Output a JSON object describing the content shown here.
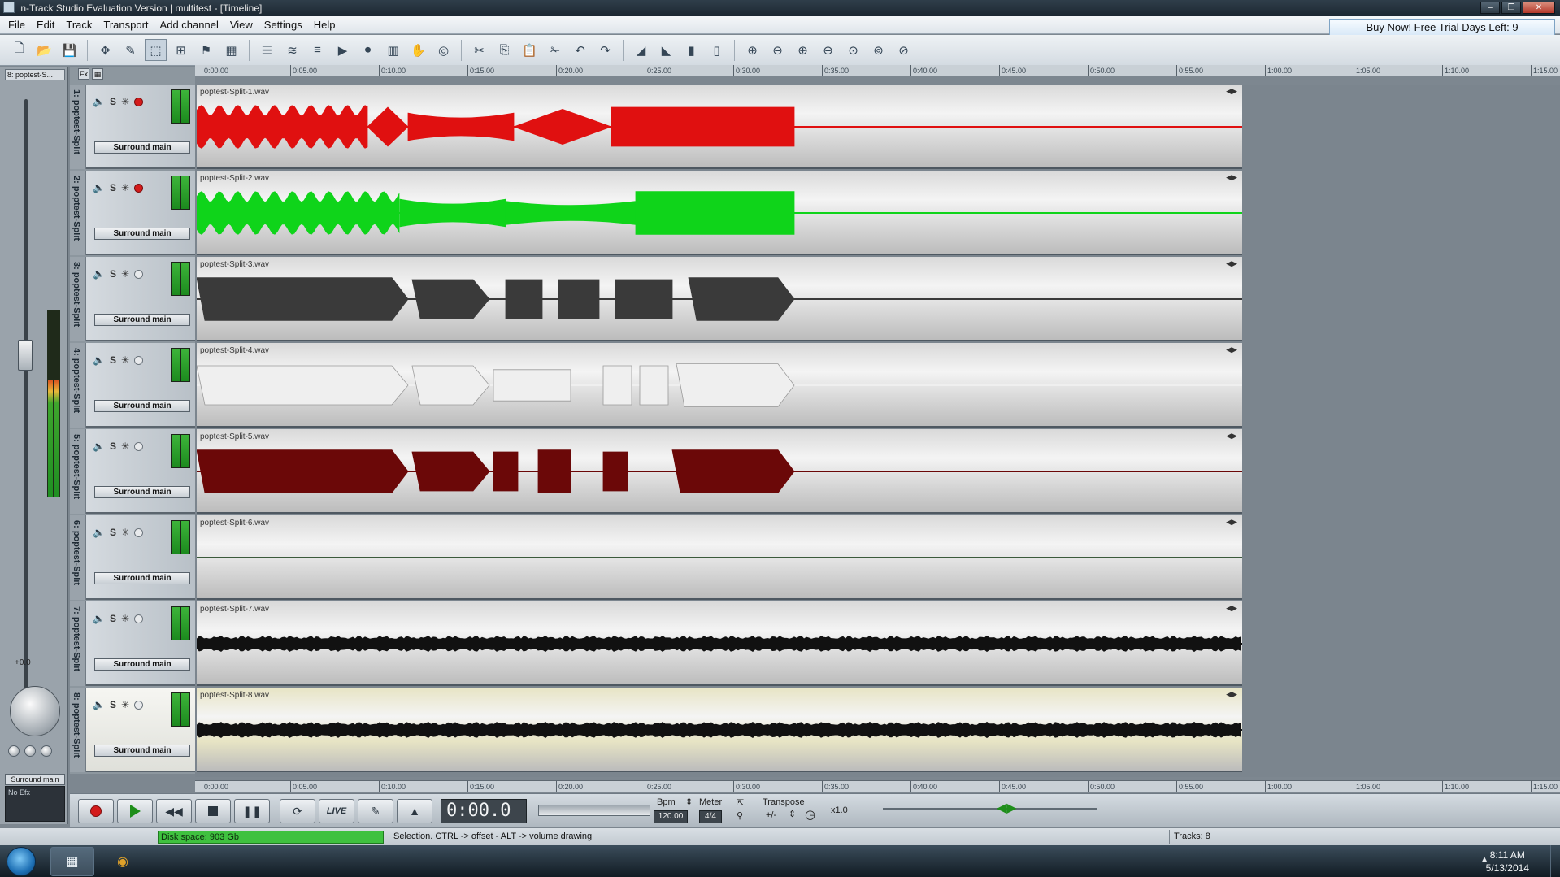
{
  "window": {
    "title": "n-Track Studio Evaluation Version | multitest - [Timeline]",
    "controls": {
      "minimize": "–",
      "maximize": "❐",
      "close": "✕"
    }
  },
  "menu": [
    "File",
    "Edit",
    "Track",
    "Transport",
    "Add channel",
    "View",
    "Settings",
    "Help"
  ],
  "buy_now": "Buy Now! Free Trial Days Left: 9",
  "toolbar_icons": [
    "new-file-icon",
    "open-file-icon",
    "save-icon",
    "move-icon",
    "edit-tool-icon",
    "select-tool-icon",
    "snap-icon",
    "marker-icon",
    "grid-icon",
    "mixer-icon",
    "eq-icon",
    "list-icon",
    "loop-play-icon",
    "record-mode-icon",
    "piano-icon",
    "hand-icon",
    "cd-icon",
    "cut-icon",
    "copy-icon",
    "paste-icon",
    "trim-icon",
    "undo-icon",
    "redo-icon",
    "fade-in-icon",
    "fade-out-icon",
    "normalize-icon",
    "meter-icon",
    "zoom-in-h-icon",
    "zoom-out-h-icon",
    "zoom-in-v-icon",
    "zoom-out-v-icon",
    "zoom-fit-icon",
    "zoom-all-icon",
    "zoom-reset-icon"
  ],
  "left_strip": {
    "tab": "8: poptest-S...",
    "gain": "+0.0",
    "output": "Surround main",
    "efx": "No Efx"
  },
  "header_top": [
    "Fx",
    "▦"
  ],
  "tracks": [
    {
      "name": "1: poptest-Split",
      "clip": "poptest-Split-1.wav",
      "output": "Surround main",
      "color": "#e01010",
      "fill": "#d9d9d9",
      "armed": true
    },
    {
      "name": "2: poptest-Split",
      "clip": "poptest-Split-2.wav",
      "output": "Surround main",
      "color": "#0fd41a",
      "fill": "#d9d9d9",
      "armed": true
    },
    {
      "name": "3: poptest-Split",
      "clip": "poptest-Split-3.wav",
      "output": "Surround main",
      "color": "#3a3a3a",
      "fill": "#d9d9d9",
      "armed": false
    },
    {
      "name": "4: poptest-Split",
      "clip": "poptest-Split-4.wav",
      "output": "Surround main",
      "color": "#efefef",
      "fill": "#d9d9d9",
      "armed": false
    },
    {
      "name": "5: poptest-Split",
      "clip": "poptest-Split-5.wav",
      "output": "Surround main",
      "color": "#6b0808",
      "fill": "#d9d9d9",
      "armed": false
    },
    {
      "name": "6: poptest-Split",
      "clip": "poptest-Split-6.wav",
      "output": "Surround main",
      "color": "#3a5a3a",
      "fill": "#d9d9d9",
      "armed": false
    },
    {
      "name": "7: poptest-Split",
      "clip": "poptest-Split-7.wav",
      "output": "Surround main",
      "color": "#111111",
      "fill": "#d9d9d9",
      "armed": false
    },
    {
      "name": "8: poptest-Split",
      "clip": "poptest-Split-8.wav",
      "output": "Surround main",
      "color": "#111111",
      "fill": "#e7e4c4",
      "armed": false
    }
  ],
  "ruler": [
    "0:00.00",
    "0:05.00",
    "0:10.00",
    "0:15.00",
    "0:20.00",
    "0:25.00",
    "0:30.00",
    "0:35.00",
    "0:40.00",
    "0:45.00",
    "0:50.00",
    "0:55.00",
    "1:00.00",
    "1:05.00",
    "1:10.00",
    "1:15.00"
  ],
  "transport": {
    "live": "LIVE",
    "time": "0:00.0",
    "bpm_label": "Bpm",
    "bpm": "120.00",
    "meter_label": "Meter",
    "meter": "4/4",
    "transpose_label": "Transpose",
    "transpose": "+/-",
    "speed": "x1.0"
  },
  "status": {
    "disk": "Disk space: 903 Gb",
    "message": "Selection. CTRL -> offset - ALT -> volume drawing",
    "tracks": "Tracks: 8"
  },
  "taskbar": {
    "time": "8:11 AM",
    "date": "5/13/2014"
  }
}
